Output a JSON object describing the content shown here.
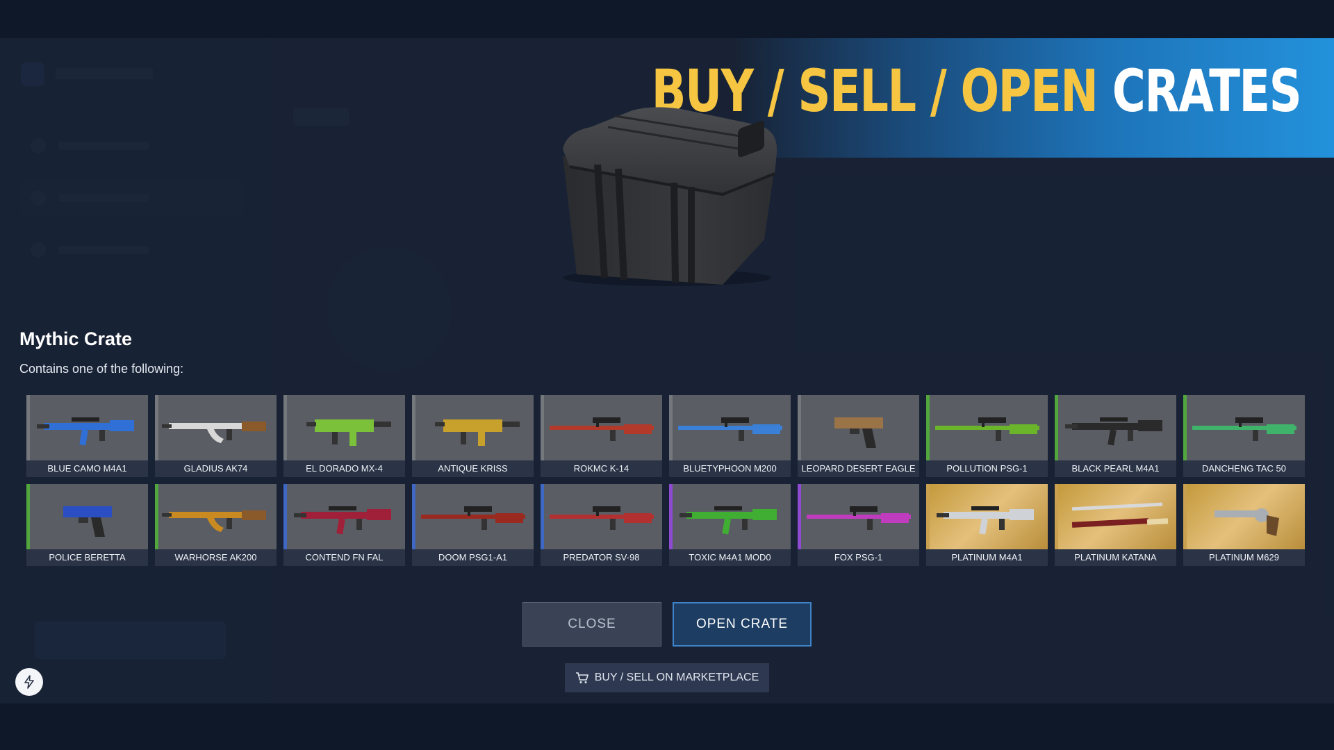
{
  "banner": {
    "part1": "BUY / SELL / OPEN",
    "part2": "CRATES"
  },
  "crate": {
    "title": "Mythic Crate",
    "subtitle": "Contains one of the following:"
  },
  "items": [
    {
      "name": "BLUE CAMO M4A1",
      "rarity": "gray",
      "weapon": "rifle",
      "color": "#2f6fd6"
    },
    {
      "name": "GLADIUS AK74",
      "rarity": "gray",
      "weapon": "ak",
      "color": "#d8d8d8"
    },
    {
      "name": "EL DORADO MX-4",
      "rarity": "gray",
      "weapon": "smg",
      "color": "#7bc23a"
    },
    {
      "name": "ANTIQUE KRISS",
      "rarity": "gray",
      "weapon": "smg",
      "color": "#c8a02c"
    },
    {
      "name": "ROKMC K-14",
      "rarity": "gray",
      "weapon": "sniper",
      "color": "#b33a2a"
    },
    {
      "name": "BLUETYPHOON M200",
      "rarity": "gray",
      "weapon": "sniper",
      "color": "#3a7fd8"
    },
    {
      "name": "LEOPARD DESERT EAGLE",
      "rarity": "gray",
      "weapon": "pistol",
      "color": "#9a7447"
    },
    {
      "name": "POLLUTION PSG-1",
      "rarity": "green",
      "weapon": "sniper",
      "color": "#6ab52a"
    },
    {
      "name": "BLACK PEARL M4A1",
      "rarity": "green",
      "weapon": "rifle",
      "color": "#2a2a2a"
    },
    {
      "name": "DANCHENG TAC 50",
      "rarity": "green",
      "weapon": "sniper",
      "color": "#3fb36a"
    },
    {
      "name": "POLICE BERETTA",
      "rarity": "green",
      "weapon": "pistol",
      "color": "#2b4fc2"
    },
    {
      "name": "WARHORSE AK200",
      "rarity": "green",
      "weapon": "ak",
      "color": "#c98a22"
    },
    {
      "name": "CONTEND FN FAL",
      "rarity": "blue",
      "weapon": "rifle",
      "color": "#a0203a"
    },
    {
      "name": "DOOM PSG1-A1",
      "rarity": "blue",
      "weapon": "sniper",
      "color": "#9a2a20"
    },
    {
      "name": "PREDATOR SV-98",
      "rarity": "blue",
      "weapon": "sniper",
      "color": "#b23030"
    },
    {
      "name": "TOXIC M4A1 MOD0",
      "rarity": "purple",
      "weapon": "rifle",
      "color": "#3fae32"
    },
    {
      "name": "FOX PSG-1",
      "rarity": "purple",
      "weapon": "sniper",
      "color": "#c03cbf"
    },
    {
      "name": "PLATINUM M4A1",
      "rarity": "gold",
      "weapon": "rifle",
      "color": "#cfd3d8"
    },
    {
      "name": "PLATINUM KATANA",
      "rarity": "gold",
      "weapon": "katana",
      "color": "#7a2020"
    },
    {
      "name": "PLATINUM M629",
      "rarity": "gold",
      "weapon": "revolver",
      "color": "#a9aeb5"
    }
  ],
  "buttons": {
    "close": "CLOSE",
    "open": "OPEN CRATE",
    "marketplace": "BUY / SELL ON MARKETPLACE"
  }
}
